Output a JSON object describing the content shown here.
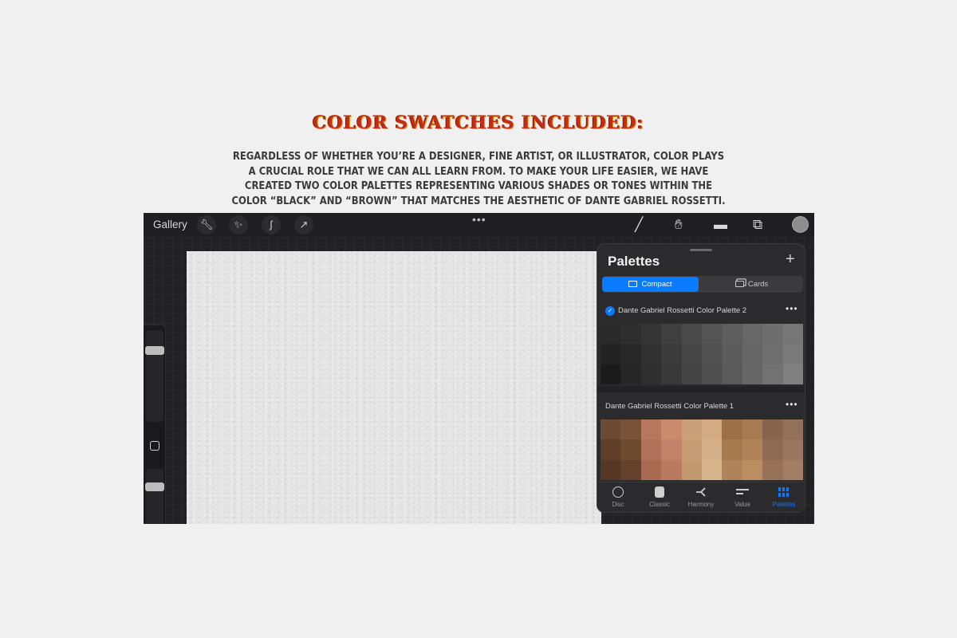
{
  "headline": "Color Swatches Included:",
  "body_copy": "Regardless of whether you’re a designer, fine artist, or illustrator, color plays a crucial role that we can all learn from. To make your life easier, we have created two color palettes representing various shades or tones within the color “black” and “brown” that matches the aesthetic of Dante Gabriel Rossetti.",
  "toolbar": {
    "gallery_label": "Gallery",
    "left_tools": [
      "wrench-icon",
      "magic-wand-icon",
      "selection-icon",
      "transform-arrow-icon"
    ],
    "right_tools": [
      "brush-icon",
      "smudge-icon",
      "eraser-icon",
      "layers-icon"
    ],
    "center_more": "•••"
  },
  "panel": {
    "title": "Palettes",
    "add_label": "+",
    "view_modes": [
      {
        "label": "Compact",
        "active": true
      },
      {
        "label": "Cards",
        "active": false
      }
    ],
    "palettes": [
      {
        "name": "Dante Gabriel Rossetti Color Palette 2",
        "default": true,
        "more": "•••",
        "swatches": [
          "#2a2a2a",
          "#2e2e2e",
          "#353535",
          "#404040",
          "#4a4a4a",
          "#545454",
          "#5e5e5e",
          "#676767",
          "#6e6e6e",
          "#767676",
          "#232323",
          "#282828",
          "#313131",
          "#3b3b3b",
          "#464646",
          "#515151",
          "#5b5b5b",
          "#656565",
          "#6f6f6f",
          "#7a7a7a",
          "#1b1b1b",
          "#262626",
          "#2f2f2f",
          "#393939",
          "#444444",
          "#4f4f4f",
          "#5a5a5a",
          "#666666",
          "#727272",
          "#808080"
        ]
      },
      {
        "name": "Dante Gabriel Rossetti Color Palette 1",
        "default": false,
        "more": "•••",
        "swatches": [
          "#6d4a33",
          "#7a5238",
          "#b7775e",
          "#c98a6d",
          "#c9a07a",
          "#d2ab85",
          "#9e7048",
          "#a87a52",
          "#86644d",
          "#93705a",
          "#5f3f2a",
          "#6e4a31",
          "#b0725a",
          "#c08268",
          "#c69c75",
          "#d4b08a",
          "#a77a4e",
          "#b08458",
          "#8e6b52",
          "#9a7660",
          "#563724",
          "#64412b",
          "#a86b52",
          "#b87a60",
          "#c2986f",
          "#d8b48d",
          "#b0845a",
          "#ba8e62",
          "#977257",
          "#a37d65"
        ]
      }
    ],
    "tabs": [
      {
        "label": "Disc",
        "icon": "disc-icon",
        "active": false
      },
      {
        "label": "Classic",
        "icon": "classic-icon",
        "active": false
      },
      {
        "label": "Harmony",
        "icon": "harmony-icon",
        "active": false
      },
      {
        "label": "Value",
        "icon": "value-icon",
        "active": false
      },
      {
        "label": "Palettes",
        "icon": "palettes-icon",
        "active": true
      }
    ]
  },
  "colors": {
    "accent": "#0a7aff",
    "headline": "#c62b13"
  }
}
